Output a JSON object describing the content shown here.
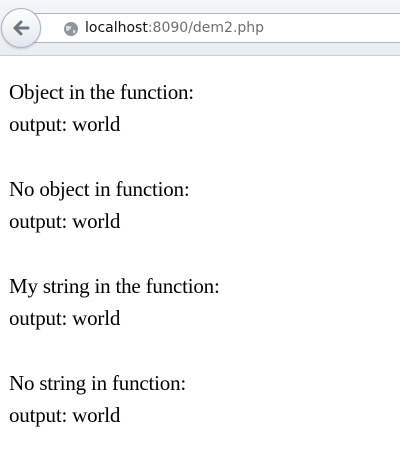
{
  "browser": {
    "url_host": "localhost",
    "url_path": ":8090/dem2.php"
  },
  "page": {
    "blocks": [
      {
        "heading": "Object in the function:",
        "output": "output: world"
      },
      {
        "heading": "No object in function:",
        "output": "output: world"
      },
      {
        "heading": "My string in the function:",
        "output": "output: world"
      },
      {
        "heading": "No string in function:",
        "output": "output: world"
      }
    ]
  }
}
